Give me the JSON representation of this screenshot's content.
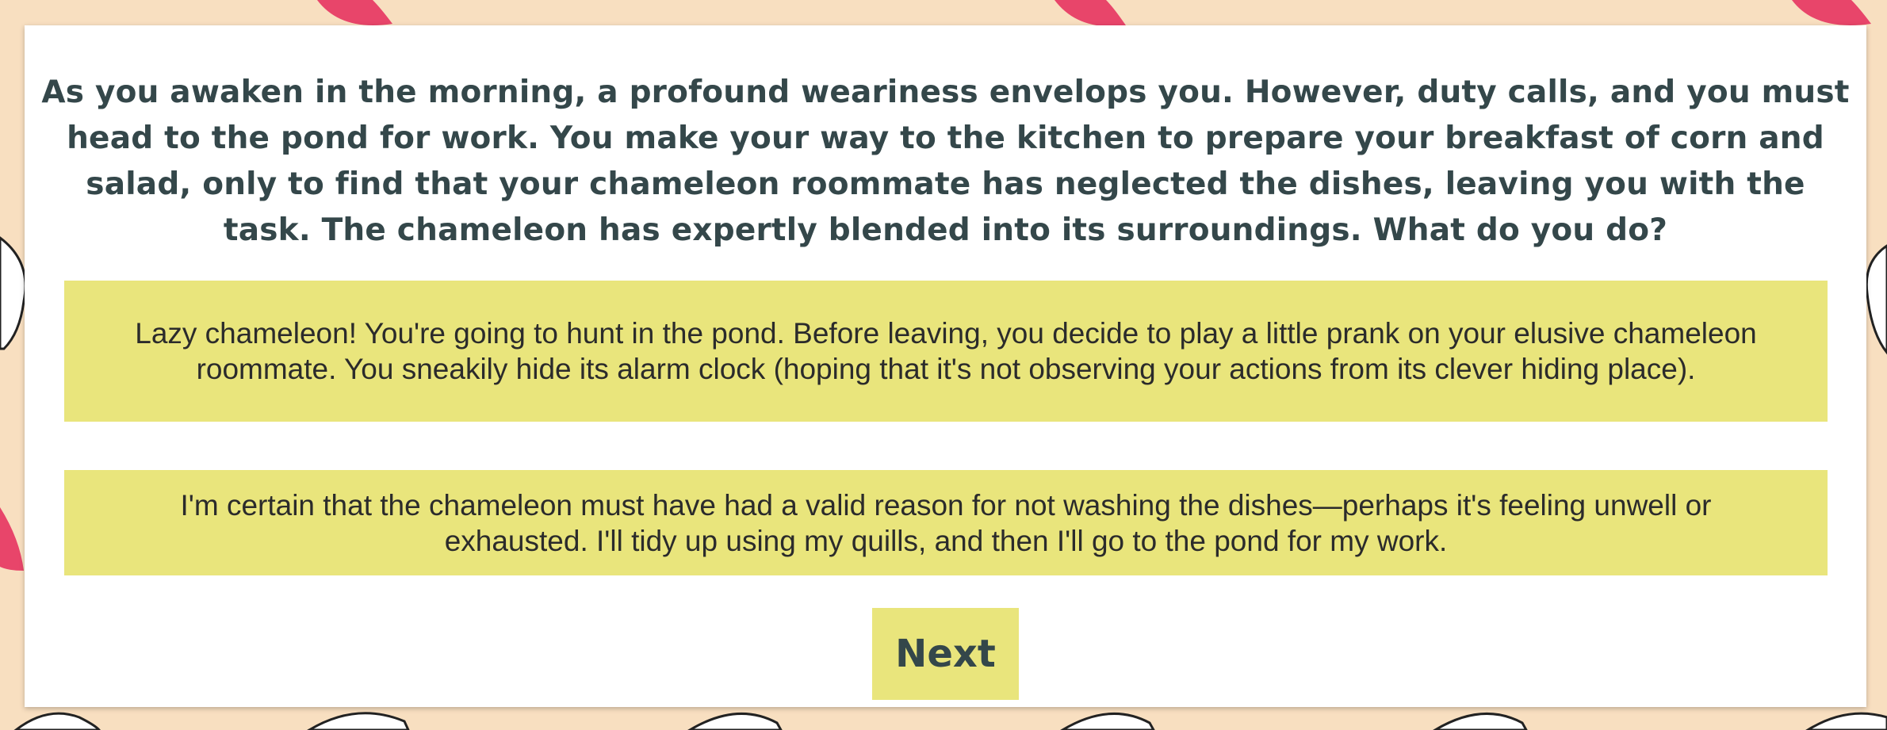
{
  "story": {
    "question": "As you awaken in the morning, a profound weariness envelops you. However, duty calls, and you must head to the pond for work. You make your way to the kitchen to prepare your breakfast of corn and salad, only to find that your chameleon roommate has neglected the dishes, leaving you with the task. The chameleon has expertly blended into its surroundings. What do you do?",
    "options": [
      {
        "label": "Lazy chameleon! You're going to hunt in the pond. Before leaving, you decide to play a little prank on your elusive chameleon roommate. You sneakily hide its alarm clock (hoping that it's not observing your actions from its clever hiding place)."
      },
      {
        "label": "I'm certain that the chameleon must have had a valid reason for not washing the dishes—perhaps it's feeling unwell or exhausted. I'll tidy up using my quills, and then I'll go to the pond for my work."
      }
    ],
    "next_label": "Next"
  },
  "colors": {
    "background": "#f8dfc0",
    "card": "#ffffff",
    "option_fill": "#e9e57c",
    "heading_text": "#34474a",
    "accent_pink": "#e8456a"
  }
}
